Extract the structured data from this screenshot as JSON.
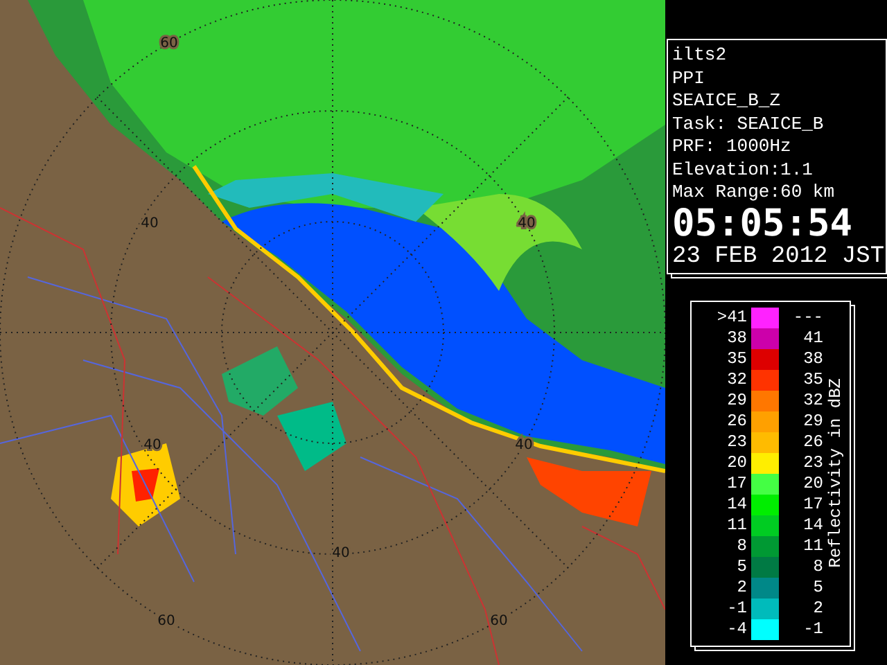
{
  "map": {
    "range_labels": [
      "60",
      "40",
      "40",
      "40",
      "40",
      "40",
      "60",
      "60"
    ]
  },
  "info": {
    "lines": [
      "ilts2",
      "PPI",
      "SEAICE_B_Z",
      "Task: SEAICE_B",
      "PRF: 1000Hz",
      "Elevation:1.1",
      "Max Range:60 km"
    ],
    "time": "05:05:54",
    "date": "23 FEB 2012 JST"
  },
  "legend": {
    "title": "Reflectivity in dBZ",
    "rows": [
      {
        "low": ">41",
        "high": "---",
        "color": "#ff22ff"
      },
      {
        "low": "38",
        "high": "41",
        "color": "#cc00aa"
      },
      {
        "low": "35",
        "high": "38",
        "color": "#dd0000"
      },
      {
        "low": "32",
        "high": "35",
        "color": "#ff3300"
      },
      {
        "low": "29",
        "high": "32",
        "color": "#ff7700"
      },
      {
        "low": "26",
        "high": "29",
        "color": "#ffa000"
      },
      {
        "low": "23",
        "high": "26",
        "color": "#ffbb00"
      },
      {
        "low": "20",
        "high": "23",
        "color": "#ffee00"
      },
      {
        "low": "17",
        "high": "20",
        "color": "#44ff44"
      },
      {
        "low": "14",
        "high": "17",
        "color": "#00ee00"
      },
      {
        "low": "11",
        "high": "14",
        "color": "#00cc22"
      },
      {
        "low": "8",
        "high": "11",
        "color": "#009933"
      },
      {
        "low": "5",
        "high": "8",
        "color": "#007a44"
      },
      {
        "low": "2",
        "high": "5",
        "color": "#008888"
      },
      {
        "low": "-1",
        "high": "2",
        "color": "#00bbbb"
      },
      {
        "low": "-4",
        "high": "-1",
        "color": "#00ffff"
      }
    ]
  }
}
